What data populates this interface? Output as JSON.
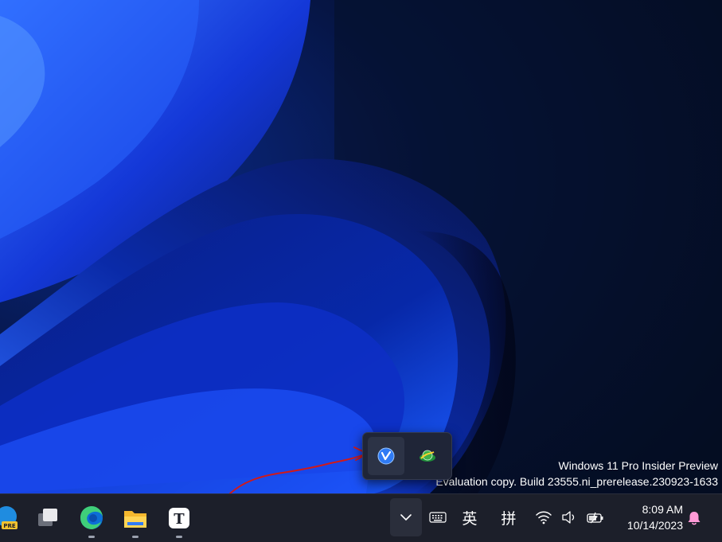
{
  "watermark": {
    "line1": "Windows 11 Pro Insider Preview",
    "line2": "Evaluation copy. Build 23555.ni_prerelease.230923-1633"
  },
  "tray_flyout": {
    "icons": [
      "v-app-icon",
      "network-globe-app-icon"
    ]
  },
  "taskbar": {
    "apps": [
      "edge-preview-icon",
      "task-view-icon",
      "edge-icon",
      "file-explorer-icon",
      "typora-icon"
    ],
    "typora_letter": "T",
    "pre_badge": "PRE"
  },
  "tray": {
    "ime_mode": "英",
    "ime_input": "拼",
    "icons": [
      "keyboard-icon",
      "wifi-icon",
      "speaker-icon",
      "battery-icon",
      "notification-bell-icon"
    ]
  },
  "clock": {
    "time": "8:09 AM",
    "date": "10/14/2023"
  },
  "colors": {
    "accent": "#2f7bf5",
    "annotation": "#d01a1a",
    "bell": "#ff9ad7",
    "taskbar": "#1c1f2a"
  }
}
